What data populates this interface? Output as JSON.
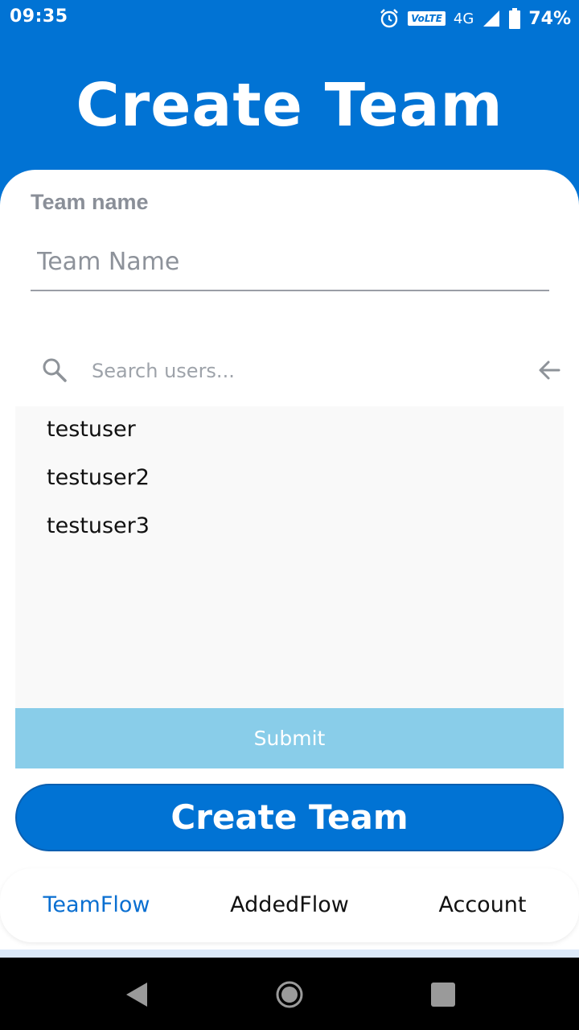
{
  "status_bar": {
    "time": "09:35",
    "volte": "VoLTE",
    "network": "4G",
    "battery": "74%"
  },
  "header": {
    "title": "Create Team"
  },
  "form": {
    "team_label": "Team name",
    "team_placeholder": "Team Name",
    "search_placeholder": "Search users..."
  },
  "users": [
    "testuser",
    "testuser2",
    "testuser3"
  ],
  "buttons": {
    "submit": "Submit",
    "create_team": "Create Team"
  },
  "bottom_nav": [
    {
      "label": "TeamFlow",
      "active": true
    },
    {
      "label": "AddedFlow",
      "active": false
    },
    {
      "label": "Account",
      "active": false
    }
  ],
  "colors": {
    "primary": "#0173d4",
    "submit_bg": "#89cde9",
    "nav_active": "#0a6fd1"
  }
}
